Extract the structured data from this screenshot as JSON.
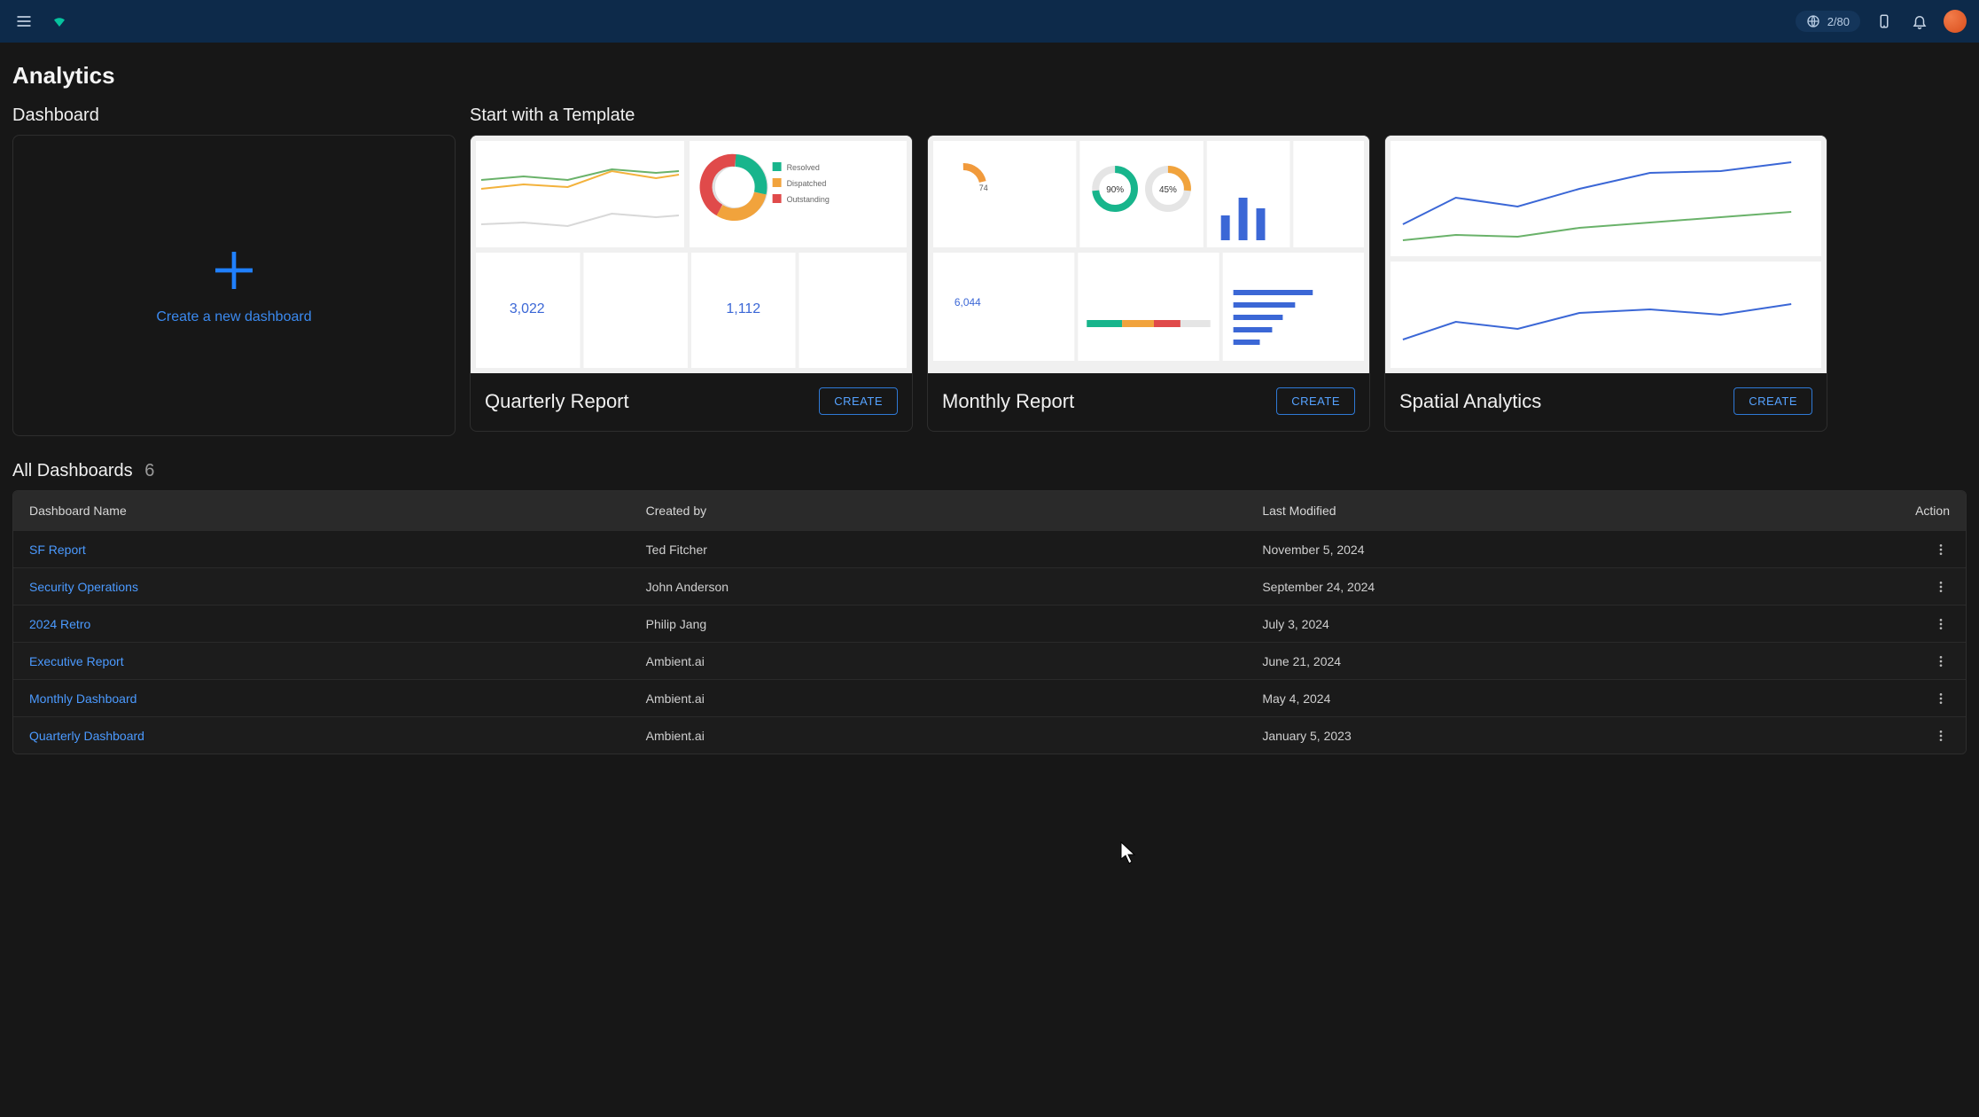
{
  "topbar": {
    "usage": "2/80"
  },
  "page_title": "Analytics",
  "sections": {
    "dashboard_heading": "Dashboard",
    "templates_heading": "Start with a Template",
    "new_dashboard_label": "Create a new dashboard"
  },
  "templates": [
    {
      "name": "Quarterly Report",
      "create_label": "CREATE"
    },
    {
      "name": "Monthly Report",
      "create_label": "CREATE"
    },
    {
      "name": "Spatial Analytics",
      "create_label": "CREATE"
    }
  ],
  "all_dashboards": {
    "heading": "All Dashboards",
    "count": "6",
    "columns": {
      "name": "Dashboard Name",
      "created_by": "Created by",
      "last_modified": "Last Modified",
      "action": "Action"
    },
    "rows": [
      {
        "name": "SF Report",
        "created_by": "Ted Fitcher",
        "last_modified": "November 5, 2024"
      },
      {
        "name": "Security Operations",
        "created_by": "John Anderson",
        "last_modified": "September 24, 2024"
      },
      {
        "name": "2024 Retro",
        "created_by": "Philip Jang",
        "last_modified": "July 3, 2024"
      },
      {
        "name": "Executive Report",
        "created_by": "Ambient.ai",
        "last_modified": "June 21, 2024"
      },
      {
        "name": "Monthly Dashboard",
        "created_by": "Ambient.ai",
        "last_modified": "May 4, 2024"
      },
      {
        "name": "Quarterly Dashboard",
        "created_by": "Ambient.ai",
        "last_modified": "January 5, 2023"
      }
    ]
  }
}
